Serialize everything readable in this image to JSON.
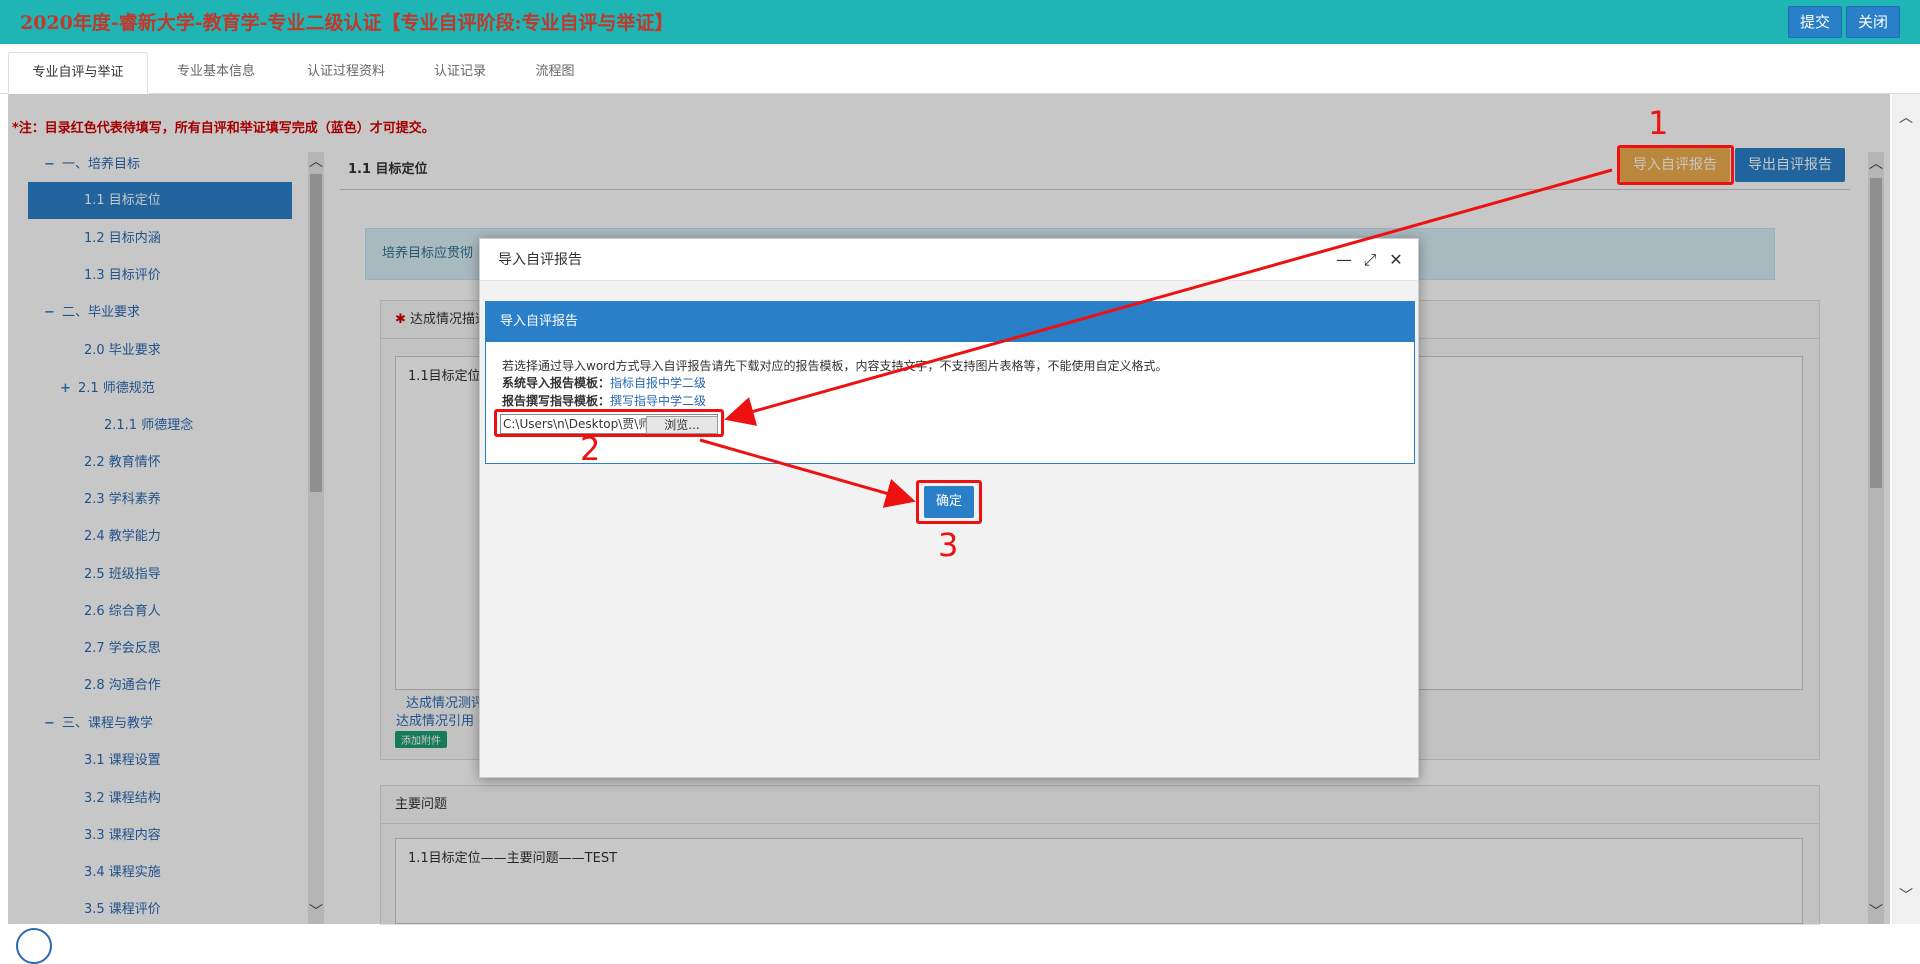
{
  "topbar": {
    "title": "2020年度-睿新大学-教育学-专业二级认证【专业自评阶段:专业自评与举证】",
    "submit_label": "提交",
    "close_label": "关闭"
  },
  "tabs": [
    {
      "label": "专业自评与举证",
      "active": true
    },
    {
      "label": "专业基本信息"
    },
    {
      "label": "认证过程资料"
    },
    {
      "label": "认证记录"
    },
    {
      "label": "流程图"
    }
  ],
  "note": "*注：目录红色代表待填写，所有自评和举证填写完成（蓝色）才可提交。",
  "tree": [
    {
      "label": "一、培养目标",
      "sign": "−"
    },
    {
      "label": "1.1 目标定位",
      "selected": true
    },
    {
      "label": "1.2 目标内涵"
    },
    {
      "label": "1.3 目标评价"
    },
    {
      "label": "二、毕业要求",
      "sign": "−"
    },
    {
      "label": "2.0 毕业要求"
    },
    {
      "label": "2.1 师德规范",
      "sign": "+"
    },
    {
      "label": "2.1.1 师德理念"
    },
    {
      "label": "2.2 教育情怀"
    },
    {
      "label": "2.3 学科素养"
    },
    {
      "label": "2.4 教学能力"
    },
    {
      "label": "2.5 班级指导"
    },
    {
      "label": "2.6 综合育人"
    },
    {
      "label": "2.7 学会反思"
    },
    {
      "label": "2.8 沟通合作"
    },
    {
      "label": "三、课程与教学",
      "sign": "−"
    },
    {
      "label": "3.1 课程设置"
    },
    {
      "label": "3.2 课程结构"
    },
    {
      "label": "3.3 课程内容"
    },
    {
      "label": "3.4 课程实施"
    },
    {
      "label": "3.5 课程评价"
    }
  ],
  "main": {
    "section_title": "1.1 目标定位",
    "import_label": "导入自评报告",
    "export_label": "导出自评报告",
    "info_text": "培养目标应贯彻",
    "achievement_head": "达成情况描述",
    "achievement_text": "1.1目标定位",
    "achievement_label1": "达成情况测评",
    "achievement_label2": "达成情况引用",
    "attach_label": "添加附件",
    "problems_head": "主要问题",
    "problems_text": "1.1目标定位——主要问题——TEST"
  },
  "dialog": {
    "title": "导入自评报告",
    "panel_head": "导入自评报告",
    "desc": "若选择通过导入word方式导入自评报告请先下载对应的报告模板，内容支持文字，不支持图片表格等，不能使用自定义格式。",
    "template_label": "系统导入报告模板：",
    "template_link": "指标自报中学二级",
    "guide_label": "报告撰写指导模板：",
    "guide_link": "撰写指导中学二级",
    "file_value": "C:\\Users\\n\\Desktop\\贾\\师",
    "browse_label": "浏览...",
    "confirm_label": "确定"
  },
  "annotations": [
    "1",
    "2",
    "3"
  ],
  "colors": {
    "topbar": "#1fb5b5",
    "primary": "#2a7fc9",
    "warning": "#f0ad4e",
    "annotation": "#ee1111"
  }
}
